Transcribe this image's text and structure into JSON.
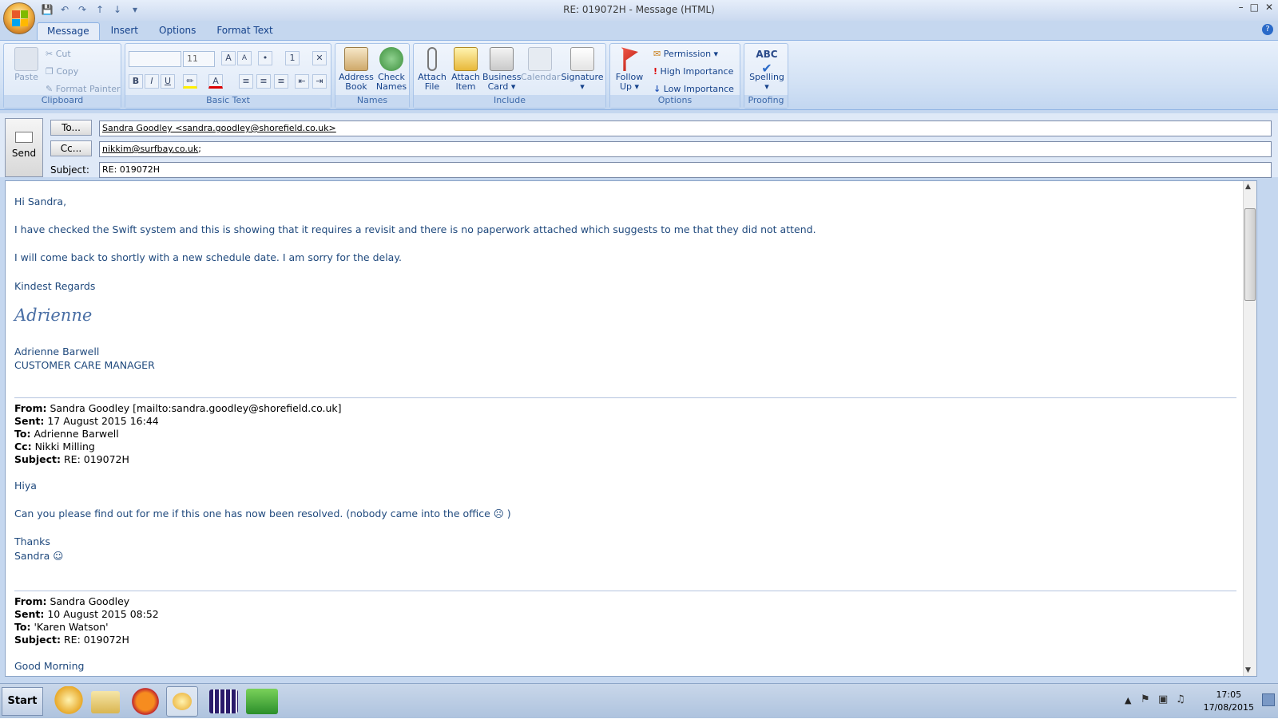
{
  "window": {
    "title": "RE: 019072H - Message (HTML)",
    "controls": [
      "–",
      "□",
      "✕"
    ]
  },
  "quick_access": {
    "icons": [
      "save-icon",
      "undo-icon",
      "redo-icon",
      "up-icon",
      "down-icon",
      "customize-icon"
    ]
  },
  "tabs": [
    {
      "label": "Message"
    },
    {
      "label": "Insert"
    },
    {
      "label": "Options"
    },
    {
      "label": "Format Text"
    }
  ],
  "ribbon": {
    "clipboard": {
      "label": "Clipboard",
      "paste": "Paste",
      "cut": "Cut",
      "copy": "Copy",
      "format_painter": "Format Painter"
    },
    "basic_text": {
      "label": "Basic Text",
      "font_size": "11",
      "bold": "B",
      "italic": "I",
      "underline": "U"
    },
    "names": {
      "label": "Names",
      "address_book_1": "Address",
      "address_book_2": "Book",
      "check_names_1": "Check",
      "check_names_2": "Names"
    },
    "include": {
      "label": "Include",
      "attach_file_1": "Attach",
      "attach_file_2": "File",
      "attach_item_1": "Attach",
      "attach_item_2": "Item",
      "business_card_1": "Business",
      "business_card_2": "Card",
      "calendar": "Calendar",
      "signature": "Signature"
    },
    "options": {
      "label": "Options",
      "follow_up_1": "Follow",
      "follow_up_2": "Up",
      "permission": "Permission",
      "high_importance": "High Importance",
      "low_importance": "Low Importance"
    },
    "proofing": {
      "label": "Proofing",
      "abc": "ABC",
      "spelling": "Spelling"
    }
  },
  "compose": {
    "send": "Send",
    "to_button": "To...",
    "cc_button": "Cc...",
    "subject_label": "Subject:",
    "to_value": "Sandra Goodley <sandra.goodley@shorefield.co.uk>",
    "cc_value": "nikkim@surfbay.co.uk",
    "cc_suffix": ";",
    "subject_value": "RE: 019072H"
  },
  "body": {
    "greeting": "Hi Sandra,",
    "line1": "I have checked the Swift system and this is showing that it requires a revisit and there is no paperwork attached which suggests to me that they did not attend.",
    "line2": "I will come back to shortly with a new schedule date.  I am sorry for the delay.",
    "closing": "Kindest Regards",
    "sig_script": "Adrienne",
    "sig_name": "Adrienne Barwell",
    "sig_title": "CUSTOMER CARE MANAGER",
    "q1": {
      "from_label": "From:",
      "from": "Sandra Goodley [mailto:sandra.goodley@shorefield.co.uk]",
      "sent_label": "Sent:",
      "sent": "17 August 2015 16:44",
      "to_label": "To:",
      "to": "Adrienne Barwell",
      "cc_label": "Cc:",
      "cc": "Nikki Milling",
      "subject_label": "Subject:",
      "subject": "RE: 019072H",
      "greet": "Hiya",
      "text": "Can you please find out for me if this one has now been resolved.  (nobody came into the office ☹ )",
      "thanks": "Thanks",
      "name": "Sandra ☺"
    },
    "q2": {
      "from_label": "From:",
      "from": "Sandra Goodley",
      "sent_label": "Sent:",
      "sent": "10 August 2015 08:52",
      "to_label": "To:",
      "to": "'Karen Watson'",
      "subject_label": "Subject:",
      "subject": "RE: 019072H",
      "partial": "Good Morning"
    }
  },
  "taskbar": {
    "start": "Start",
    "apps": [
      "outlook-icon",
      "explorer-folder-icon",
      "firefox-icon",
      "outlook-message-icon",
      "calendar-app-icon",
      "sage-icon"
    ],
    "clock_time": "17:05",
    "clock_date": "17/08/2015"
  },
  "colors": {
    "ribbon_text": "#15428b",
    "body_text": "#1f497d",
    "office_blue": "#c5d7ef"
  }
}
